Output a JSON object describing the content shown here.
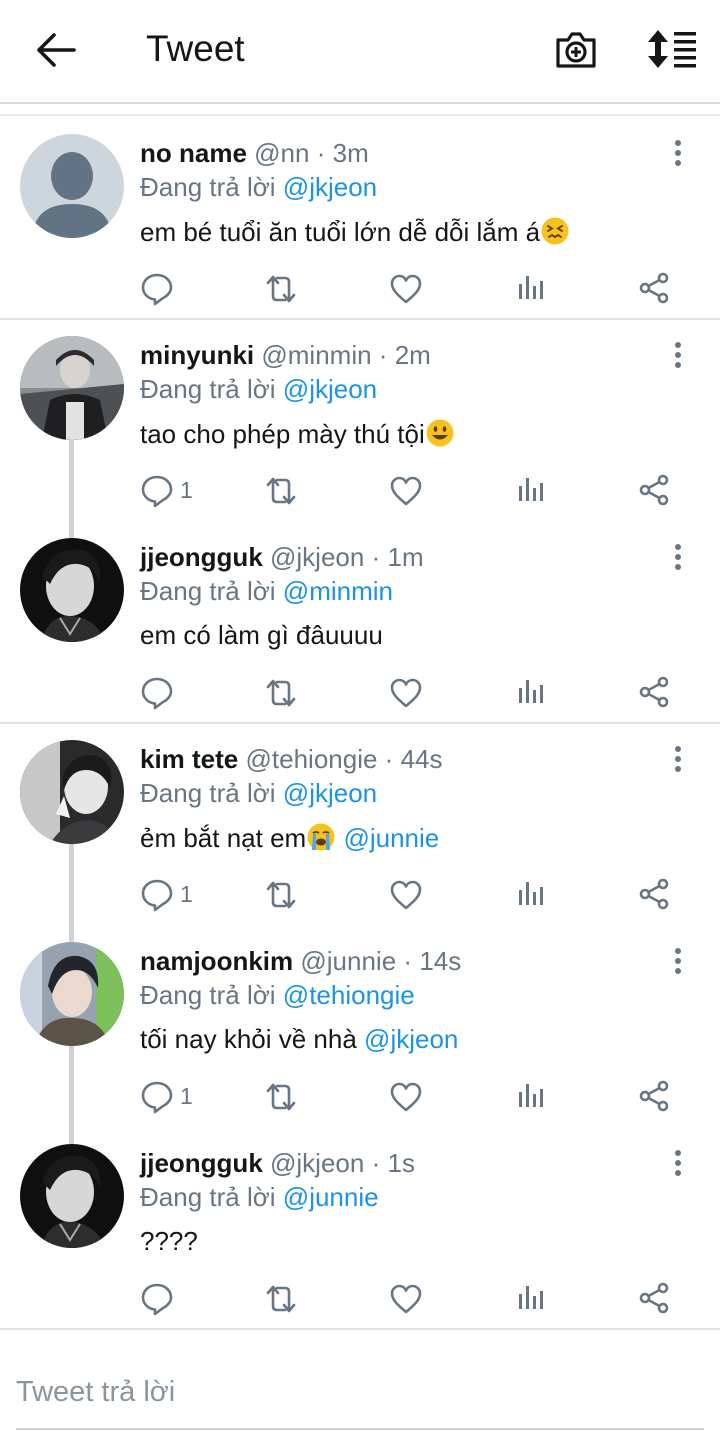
{
  "header": {
    "title": "Tweet",
    "back_icon": "arrow-left-icon",
    "camera_icon": "camera-plus-icon",
    "sort_icon": "sort-list-icon"
  },
  "tweets": [
    {
      "name": "no name",
      "handle": "@nn",
      "dot": "·",
      "time": "3m",
      "reply_prefix": "Đang trả lời",
      "reply_to": "@jkjeon",
      "text": "em bé tuổi ăn tuổi lớn dễ dỗi lắm á",
      "emoji": "confounded-face",
      "mention": "",
      "reply_count": ""
    },
    {
      "name": "minyunki",
      "handle": "@minmin",
      "dot": "·",
      "time": "2m",
      "reply_prefix": "Đang trả lời",
      "reply_to": "@jkjeon",
      "text": "tao cho phép mày thú tội",
      "emoji": "smiling-face",
      "mention": "",
      "reply_count": "1"
    },
    {
      "name": "jjeongguk",
      "handle": "@jkjeon",
      "dot": "·",
      "time": "1m",
      "reply_prefix": "Đang trả lời",
      "reply_to": "@minmin",
      "text": "em có làm gì đâuuuu",
      "emoji": "",
      "mention": "",
      "reply_count": ""
    },
    {
      "name": "kim tete",
      "handle": "@tehiongie",
      "dot": "·",
      "time": "44s",
      "reply_prefix": "Đang trả lời",
      "reply_to": "@jkjeon",
      "text": "ẻm bắt nạt em",
      "emoji": "crying-face",
      "mention": "@junnie",
      "reply_count": "1"
    },
    {
      "name": "namjoonkim",
      "handle": "@junnie",
      "dot": "·",
      "time": "14s",
      "reply_prefix": "Đang trả lời",
      "reply_to": "@tehiongie",
      "text": "tối nay khỏi về nhà",
      "emoji": "",
      "mention": "@jkjeon",
      "reply_count": "1"
    },
    {
      "name": "jjeongguk",
      "handle": "@jkjeon",
      "dot": "·",
      "time": "1s",
      "reply_prefix": "Đang trả lời",
      "reply_to": "@junnie",
      "text": "????",
      "emoji": "",
      "mention": "",
      "reply_count": ""
    }
  ],
  "composer": {
    "placeholder": "Tweet trả lời"
  },
  "colors": {
    "accent": "#1c94e0",
    "muted": "#687684",
    "text": "#14171a",
    "divider": "#e1e4e6"
  }
}
